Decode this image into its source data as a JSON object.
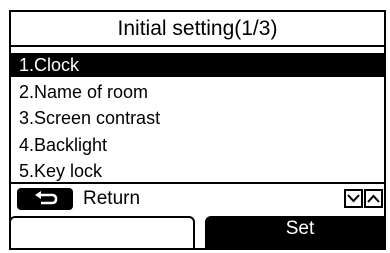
{
  "header": {
    "title": "Initial setting(1/3)"
  },
  "menu": {
    "items": [
      {
        "label": "1.Clock",
        "selected": true
      },
      {
        "label": "2.Name of room",
        "selected": false
      },
      {
        "label": "3.Screen contrast",
        "selected": false
      },
      {
        "label": "4.Backlight",
        "selected": false
      },
      {
        "label": "5.Key lock",
        "selected": false
      }
    ]
  },
  "footer": {
    "return_label": "Return",
    "return_icon": "return-arrow-icon",
    "scroll_icons": [
      "chevron-down-icon",
      "chevron-up-icon"
    ],
    "left_softkey_label": "",
    "right_softkey_label": "Set"
  }
}
